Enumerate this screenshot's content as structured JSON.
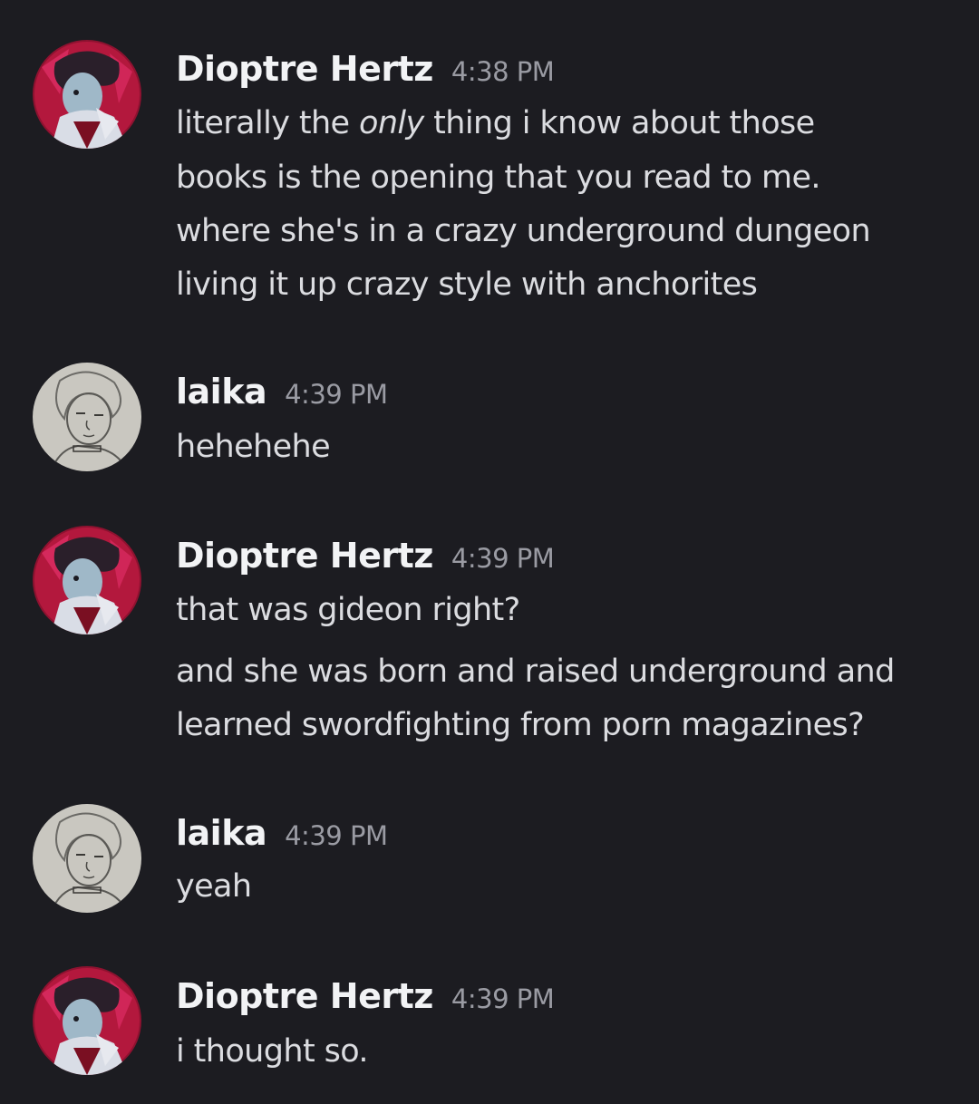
{
  "messages": [
    {
      "author": "Dioptre Hertz",
      "avatar_icon": "dioptre-avatar",
      "time": "4:38 PM",
      "lines": [
        {
          "before": "literally the ",
          "emph": "only",
          "after": " thing i know about those"
        },
        {
          "text": "books is the opening that you read to me."
        },
        {
          "text": "where she's in a crazy underground dungeon"
        },
        {
          "text": "living it up crazy style with anchorites"
        }
      ]
    },
    {
      "author": "laika",
      "avatar_icon": "laika-avatar",
      "time": "4:39 PM",
      "lines": [
        {
          "text": "hehehehe"
        }
      ]
    },
    {
      "author": "Dioptre Hertz",
      "avatar_icon": "dioptre-avatar",
      "time": "4:39 PM",
      "lines": [
        {
          "text": "that was gideon right?"
        },
        {
          "text": "and she was born and raised underground and"
        },
        {
          "text": "learned swordfighting from porn magazines?"
        }
      ]
    },
    {
      "author": "laika",
      "avatar_icon": "laika-avatar",
      "time": "4:39 PM",
      "lines": [
        {
          "text": "yeah"
        }
      ]
    },
    {
      "author": "Dioptre Hertz",
      "avatar_icon": "dioptre-avatar",
      "time": "4:39 PM",
      "lines": [
        {
          "text": "i thought so."
        }
      ]
    }
  ]
}
